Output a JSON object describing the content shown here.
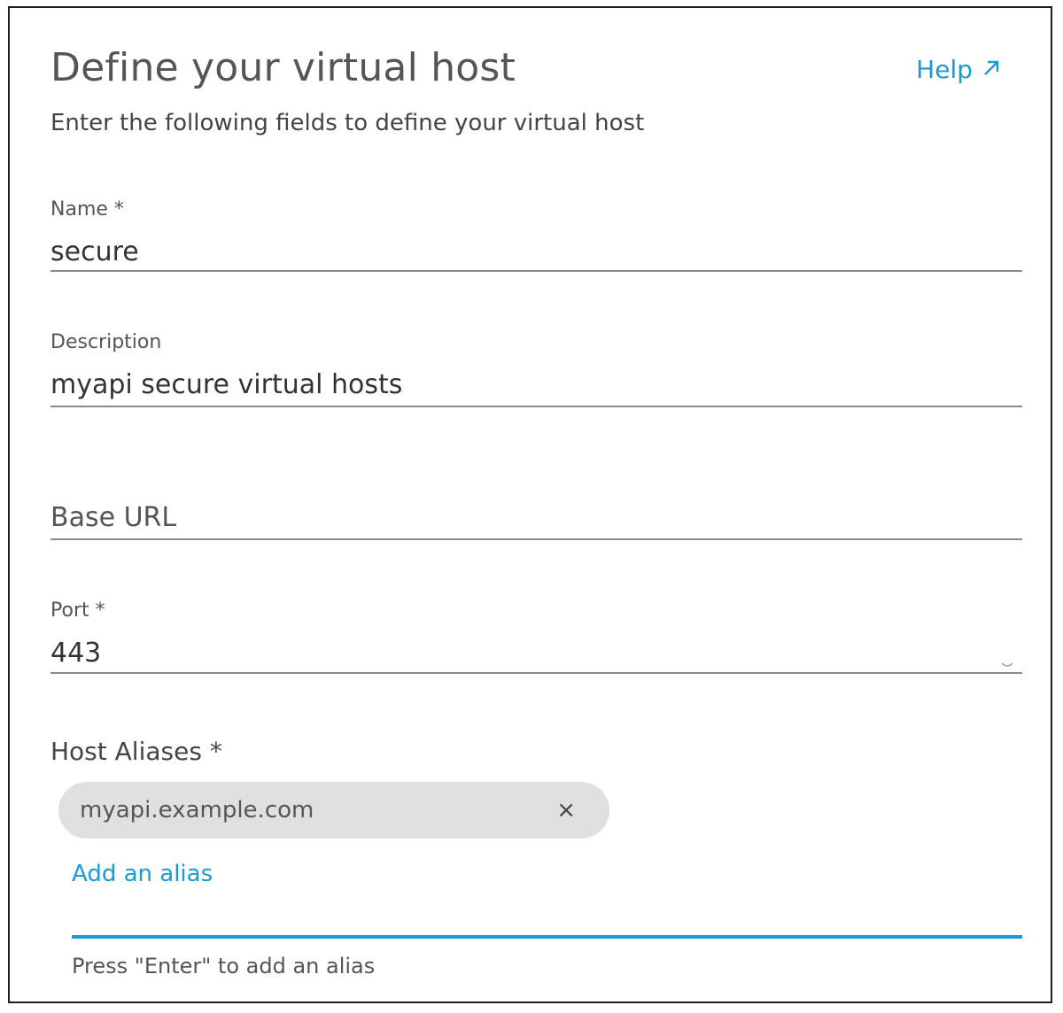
{
  "header": {
    "title": "Define your virtual host",
    "subtitle": "Enter the following fields to define your virtual host",
    "help_label": "Help"
  },
  "fields": {
    "name": {
      "label": "Name *",
      "value": "secure"
    },
    "description": {
      "label": "Description",
      "value": "myapi secure virtual hosts"
    },
    "base_url": {
      "placeholder": "Base URL"
    },
    "port": {
      "label": "Port *",
      "value": "443"
    }
  },
  "host_aliases": {
    "label": "Host Aliases *",
    "chips": [
      {
        "label": "myapi.example.com",
        "remove_glyph": "×"
      }
    ],
    "add_link": "Add an alias",
    "input_value": "",
    "hint": "Press \"Enter\" to add an alias"
  },
  "icons": {
    "help": "external-link-arrow-icon",
    "chip_remove": "close-icon",
    "port_spinner": "spinner-icon"
  },
  "colors": {
    "accent": "#1b9bd6",
    "chip_bg": "#e0e0e0",
    "border": "#1e1e1e"
  }
}
